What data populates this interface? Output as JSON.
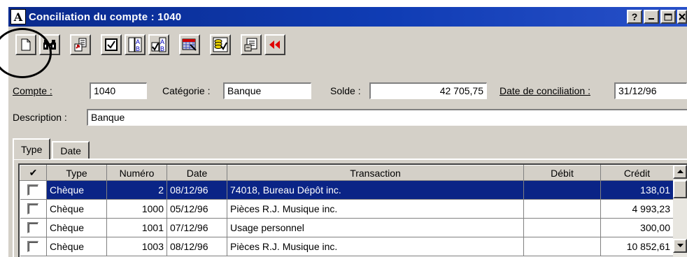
{
  "window": {
    "app_icon_letter": "A",
    "title": "Conciliation du compte : 1040",
    "buttons": {
      "help": "?",
      "minimize": "_",
      "maximize": "□",
      "close": "×"
    }
  },
  "toolbar": {
    "items": [
      "new-icon",
      "find-binoculars-icon",
      "export-icon",
      "check-icon",
      "sort-ab-icon",
      "check-ab-icon",
      "calculator-icon",
      "coins-check-icon",
      "properties-icon",
      "rewind-icon"
    ]
  },
  "form": {
    "account_label": "Compte :",
    "account_value": "1040",
    "category_label": "Catégorie :",
    "category_value": "Banque",
    "balance_label": "Solde :",
    "balance_value": "42 705,75",
    "date_label": "Date de conciliation :",
    "date_value": "31/12/96",
    "description_label": "Description :",
    "description_value": "Banque"
  },
  "tabs": [
    {
      "label": "Type",
      "active": true
    },
    {
      "label": "Date",
      "active": false
    }
  ],
  "table": {
    "columns": [
      "✔",
      "Type",
      "Numéro",
      "Date",
      "Transaction",
      "Débit",
      "Crédit"
    ],
    "rows": [
      {
        "type": "Chèque",
        "number": "2",
        "date": "08/12/96",
        "transaction": "74018, Bureau Dépôt inc.",
        "debit": "",
        "credit": "138,01",
        "selected": true
      },
      {
        "type": "Chèque",
        "number": "1000",
        "date": "05/12/96",
        "transaction": "Pièces R.J. Musique inc.",
        "debit": "",
        "credit": "4 993,23",
        "selected": false
      },
      {
        "type": "Chèque",
        "number": "1001",
        "date": "07/12/96",
        "transaction": "Usage personnel",
        "debit": "",
        "credit": "300,00",
        "selected": false
      },
      {
        "type": "Chèque",
        "number": "1003",
        "date": "08/12/96",
        "transaction": "Pièces R.J. Musique inc.",
        "debit": "",
        "credit": "10 852,61",
        "selected": false
      }
    ]
  },
  "colors": {
    "title_bar": "#0a2a8c",
    "selection": "#0a2486",
    "face": "#d4d0c8",
    "rewind_red": "#e00000"
  }
}
